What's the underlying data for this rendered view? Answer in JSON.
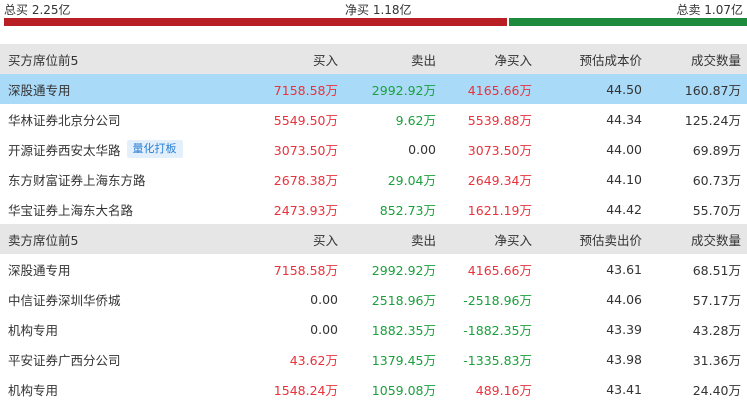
{
  "summary": {
    "total_buy": "总买 2.25亿",
    "net_buy": "净买 1.18亿",
    "total_sell": "总卖 1.07亿",
    "buy_share": 0.677
  },
  "buy_section": {
    "headers": [
      "买方席位前5",
      "买入",
      "卖出",
      "净买入",
      "预估成本价",
      "成交数量"
    ],
    "rows": [
      {
        "name": "深股通专用",
        "buy": "7158.58万",
        "sell": "2992.92万",
        "net": "4165.66万",
        "price": "44.50",
        "volume": "160.87万",
        "tag": ""
      },
      {
        "name": "华林证券北京分公司",
        "buy": "5549.50万",
        "sell": "9.62万",
        "net": "5539.88万",
        "price": "44.34",
        "volume": "125.24万",
        "tag": ""
      },
      {
        "name": "开源证券西安太华路",
        "buy": "3073.50万",
        "sell": "0.00",
        "net": "3073.50万",
        "price": "44.00",
        "volume": "69.89万",
        "tag": "量化打板"
      },
      {
        "name": "东方财富证券上海东方路",
        "buy": "2678.38万",
        "sell": "29.04万",
        "net": "2649.34万",
        "price": "44.10",
        "volume": "60.73万",
        "tag": ""
      },
      {
        "name": "华宝证券上海东大名路",
        "buy": "2473.93万",
        "sell": "852.73万",
        "net": "1621.19万",
        "price": "44.42",
        "volume": "55.70万",
        "tag": ""
      }
    ]
  },
  "sell_section": {
    "headers": [
      "卖方席位前5",
      "买入",
      "卖出",
      "净买入",
      "预估卖出价",
      "成交数量"
    ],
    "rows": [
      {
        "name": "深股通专用",
        "buy": "7158.58万",
        "sell": "2992.92万",
        "net": "4165.66万",
        "price": "43.61",
        "volume": "68.51万"
      },
      {
        "name": "中信证券深圳华侨城",
        "buy": "0.00",
        "sell": "2518.96万",
        "net": "-2518.96万",
        "price": "44.06",
        "volume": "57.17万"
      },
      {
        "name": "机构专用",
        "buy": "0.00",
        "sell": "1882.35万",
        "net": "-1882.35万",
        "price": "43.39",
        "volume": "43.28万"
      },
      {
        "name": "平安证券广西分公司",
        "buy": "43.62万",
        "sell": "1379.45万",
        "net": "-1335.83万",
        "price": "43.98",
        "volume": "31.36万"
      },
      {
        "name": "机构专用",
        "buy": "1548.24万",
        "sell": "1059.08万",
        "net": "489.16万",
        "price": "43.41",
        "volume": "24.40万"
      }
    ]
  },
  "colors": {
    "up": "#e8323c",
    "down": "#1aa03c",
    "neutral": "#333333",
    "highlight_row": "#a9daf7",
    "header_bg": "#e6e6e6"
  }
}
